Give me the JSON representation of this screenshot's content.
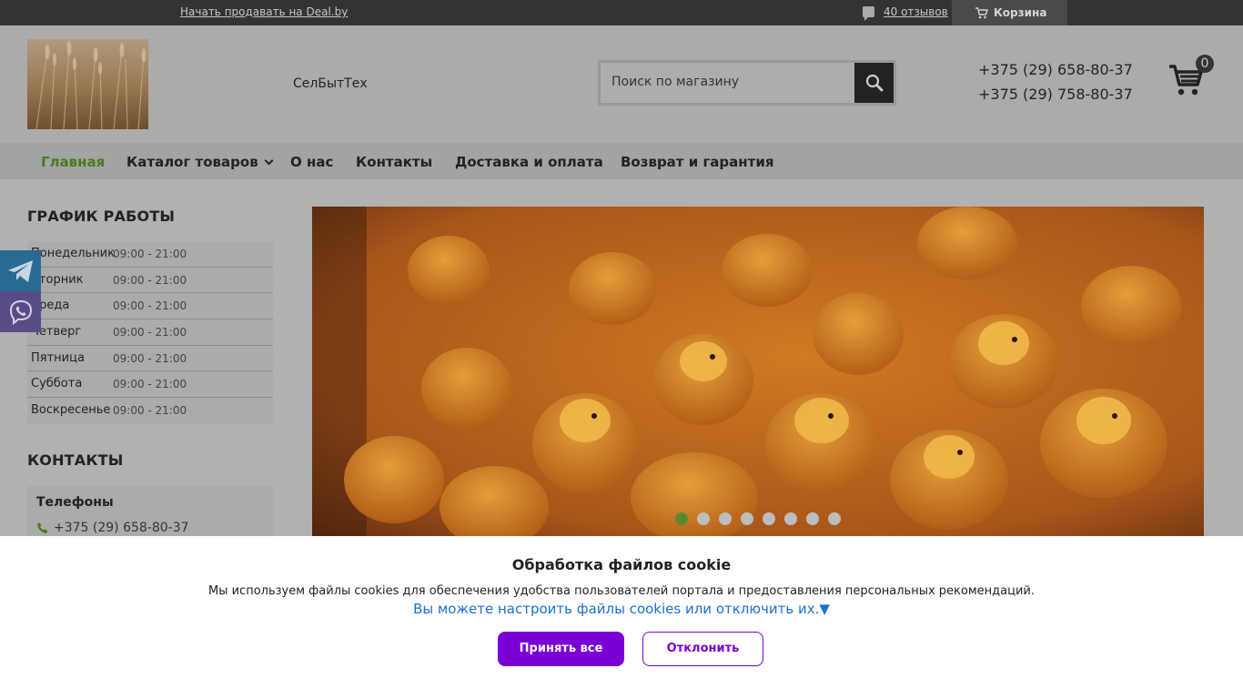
{
  "topbar": {
    "sell_link": "Начать продавать на Deal.by",
    "reviews_link": "40 отзывов",
    "cart_label": "Корзина"
  },
  "header": {
    "shop_name": "СелБытТех",
    "search_placeholder": "Поиск по магазину",
    "phones": [
      "+375 (29) 658-80-37",
      "+375 (29) 758-80-37"
    ],
    "cart_count": "0"
  },
  "nav": {
    "items": [
      {
        "label": "Главная",
        "active": true
      },
      {
        "label": "Каталог товаров",
        "dropdown": true
      },
      {
        "label": "О нас"
      },
      {
        "label": "Контакты"
      },
      {
        "label": "Доставка и оплата"
      },
      {
        "label": "Возврат и гарантия"
      }
    ]
  },
  "sidebar": {
    "schedule_title": "ГРАФИК РАБОТЫ",
    "schedule": [
      {
        "day": "Понедельник",
        "time": "09:00 - 21:00"
      },
      {
        "day": "Вторник",
        "time": "09:00 - 21:00"
      },
      {
        "day": "Среда",
        "time": "09:00 - 21:00"
      },
      {
        "day": "Четверг",
        "time": "09:00 - 21:00"
      },
      {
        "day": "Пятница",
        "time": "09:00 - 21:00"
      },
      {
        "day": "Суббота",
        "time": "09:00 - 21:00"
      },
      {
        "day": "Воскресенье",
        "time": "09:00 - 21:00"
      }
    ],
    "contacts_title": "КОНТАКТЫ",
    "phones_label": "Телефоны",
    "contact_phone": "+375 (29) 658-80-37"
  },
  "slider": {
    "slide_count": 8,
    "active_index": 0
  },
  "cookie": {
    "title": "Обработка файлов cookie",
    "description": "Мы используем файлы cookies для обеспечения удобства пользователей портала и предоставления персональных рекомендаций.",
    "settings_link": "Вы можете настроить файлы cookies или отключить их.▼",
    "accept_label": "Принять все",
    "reject_label": "Отклонить"
  },
  "colors": {
    "accent_green": "#5a8a2e",
    "cookie_purple": "#7b00d6",
    "link_blue": "#1c6fd6",
    "telegram": "#2a6a92",
    "viber": "#5a4b88"
  }
}
